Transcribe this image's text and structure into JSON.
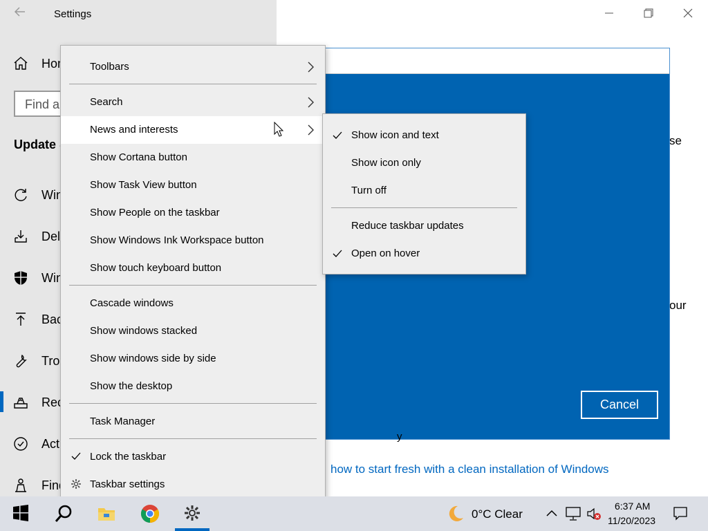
{
  "window": {
    "title": "Settings"
  },
  "sidebar": {
    "home_label": "Hom",
    "search_placeholder": "Find a",
    "section_title": "Update &",
    "items": [
      {
        "label": "Win",
        "icon": "refresh-icon"
      },
      {
        "label": "Deli",
        "icon": "delivery-icon"
      },
      {
        "label": "Win",
        "icon": "shield-icon"
      },
      {
        "label": "Bac",
        "icon": "backup-icon"
      },
      {
        "label": "Trou",
        "icon": "wrench-icon"
      },
      {
        "label": "Rec",
        "icon": "recovery-icon"
      },
      {
        "label": "Acti",
        "icon": "check-circle-icon"
      },
      {
        "label": "Find",
        "icon": "person-icon"
      }
    ]
  },
  "main": {
    "fragment_1": "se",
    "fragment_2": "our",
    "fragment_3": "y",
    "link_text": "how to start fresh with a clean installation of Windows"
  },
  "dialog": {
    "cancel_label": "Cancel"
  },
  "context_menu": {
    "items": [
      {
        "label": "Toolbars",
        "submenu": true
      },
      {
        "label": "Search",
        "submenu": true
      },
      {
        "label": "News and interests",
        "submenu": true
      },
      {
        "label": "Show Cortana button"
      },
      {
        "label": "Show Task View button"
      },
      {
        "label": "Show People on the taskbar"
      },
      {
        "label": "Show Windows Ink Workspace button"
      },
      {
        "label": "Show touch keyboard button"
      },
      {
        "label": "Cascade windows"
      },
      {
        "label": "Show windows stacked"
      },
      {
        "label": "Show windows side by side"
      },
      {
        "label": "Show the desktop"
      },
      {
        "label": "Task Manager"
      },
      {
        "label": "Lock the taskbar",
        "checked": true
      },
      {
        "label": "Taskbar settings",
        "icon": "gear-icon"
      }
    ]
  },
  "submenu": {
    "items": [
      {
        "label": "Show icon and text",
        "checked": true
      },
      {
        "label": "Show icon only",
        "checked": false
      },
      {
        "label": "Turn off",
        "checked": false
      },
      {
        "label": "Reduce taskbar updates",
        "checked": false
      },
      {
        "label": "Open on hover",
        "checked": true
      }
    ]
  },
  "taskbar": {
    "weather": "0°C  Clear",
    "time": "6:37 AM",
    "date": "11/20/2023"
  },
  "colors": {
    "accent": "#0067c0",
    "dialog_blue": "#0063b1",
    "menu_bg": "#eeeeee",
    "taskbar_bg": "#dcdfe6"
  }
}
